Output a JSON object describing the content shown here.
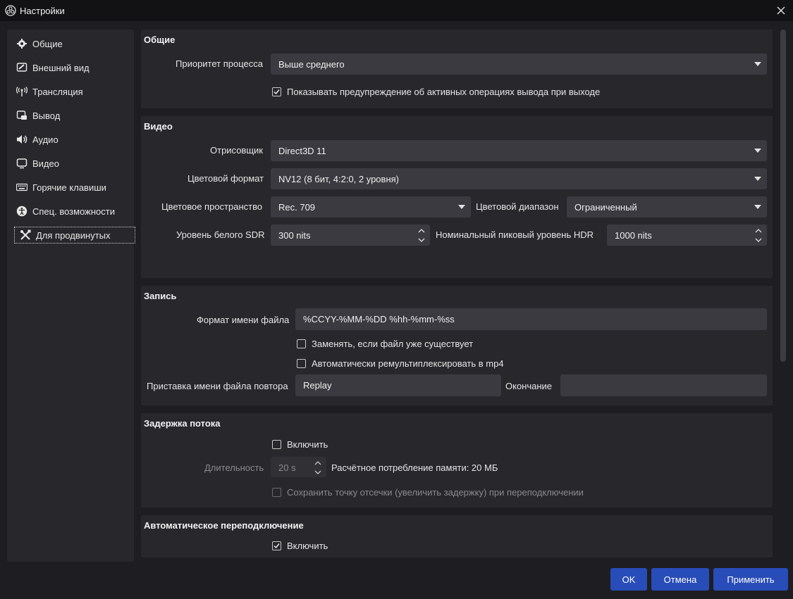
{
  "window": {
    "title": "Настройки"
  },
  "sidebar": {
    "items": [
      {
        "label": "Общие",
        "icon": "gear-icon"
      },
      {
        "label": "Внешний вид",
        "icon": "palette-icon"
      },
      {
        "label": "Трансляция",
        "icon": "broadcast-icon"
      },
      {
        "label": "Вывод",
        "icon": "output-icon"
      },
      {
        "label": "Аудио",
        "icon": "speaker-icon"
      },
      {
        "label": "Видео",
        "icon": "monitor-icon"
      },
      {
        "label": "Горячие клавиши",
        "icon": "keyboard-icon"
      },
      {
        "label": "Спец. возможности",
        "icon": "accessibility-icon"
      },
      {
        "label": "Для продвинутых",
        "icon": "tools-icon"
      }
    ],
    "selected_index": 8
  },
  "general": {
    "title": "Общие",
    "priority_label": "Приоритет процесса",
    "priority_value": "Выше среднего",
    "warn_label": "Показывать предупреждение об активных операциях вывода при выходе",
    "warn_checked": true
  },
  "video": {
    "title": "Видео",
    "renderer_label": "Отрисовщик",
    "renderer_value": "Direct3D 11",
    "color_format_label": "Цветовой формат",
    "color_format_value": "NV12 (8 бит, 4:2:0, 2 уровня)",
    "color_space_label": "Цветовое пространство",
    "color_space_value": "Rec. 709",
    "color_range_label": "Цветовой диапазон",
    "color_range_value": "Ограниченный",
    "sdr_label": "Уровень белого SDR",
    "sdr_value": "300 nits",
    "hdr_label": "Номинальный пиковый уровень HDR",
    "hdr_value": "1000 nits"
  },
  "recording": {
    "title": "Запись",
    "filename_label": "Формат имени файла",
    "filename_value": "%CCYY-%MM-%DD %hh-%mm-%ss",
    "overwrite_label": "Заменять, если файл уже существует",
    "overwrite_checked": false,
    "remux_label": "Автоматически ремультиплексировать в mp4",
    "remux_checked": false,
    "replay_prefix_label": "Приставка имени файла повтора",
    "replay_prefix_value": "Replay",
    "suffix_label": "Окончание",
    "suffix_value": ""
  },
  "stream_delay": {
    "title": "Задержка потока",
    "enable_label": "Включить",
    "enable_checked": false,
    "duration_label": "Длительность",
    "duration_value": "20 s",
    "memory_text": "Расчётное потребление памяти: 20 МБ",
    "preserve_label": "Сохранить точку отсечки (увеличить задержку) при переподключении",
    "preserve_checked": false
  },
  "reconnect": {
    "title": "Автоматическое переподключение",
    "enable_label": "Включить",
    "enable_checked": true
  },
  "buttons": {
    "ok": "OK",
    "cancel": "Отмена",
    "apply": "Применить"
  },
  "colors": {
    "accent": "#284cb8",
    "panel": "#28282c",
    "field": "#3a3a40",
    "background": "#1e1e22"
  }
}
